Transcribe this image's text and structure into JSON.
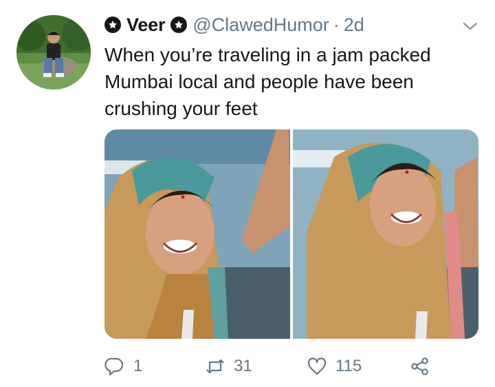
{
  "user": {
    "name": "Veer",
    "handle": "@ClawedHumor",
    "separator": "·",
    "time": "2d"
  },
  "tweet": {
    "text": "When you’re traveling in a jam packed Mumbai local and people have been crushing your feet"
  },
  "actions": {
    "replies": "1",
    "retweets": "31",
    "likes": "115"
  },
  "icons": [
    "star-badge-icon",
    "chevron-down-icon",
    "reply-icon",
    "retweet-icon",
    "heart-icon",
    "share-icon"
  ],
  "colors": {
    "text": "#14171a",
    "secondary": "#657786",
    "background": "#ffffff"
  }
}
